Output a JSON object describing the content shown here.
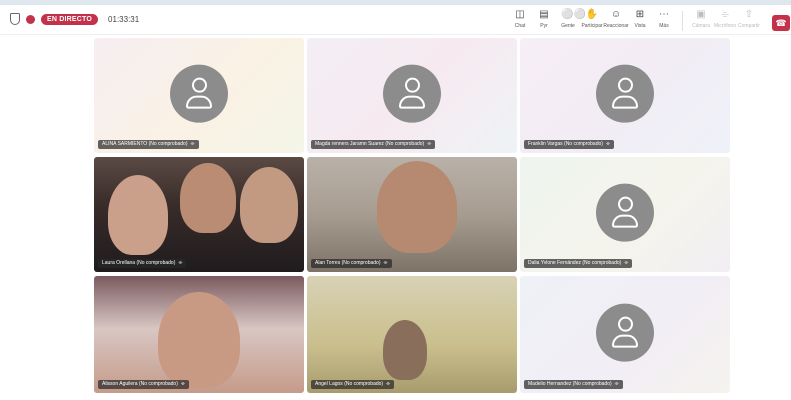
{
  "header": {
    "live_label": "EN DIRECTO",
    "timer": "01:33:31"
  },
  "toolbar": {
    "items": [
      {
        "label": "Chat",
        "icon": "chat-icon"
      },
      {
        "label": "Pyr",
        "icon": "qa-icon"
      },
      {
        "label": "Gente",
        "icon": "people-icon"
      },
      {
        "label": "Participar",
        "icon": "hand-icon"
      },
      {
        "label": "Reaccionar",
        "icon": "smile-icon"
      },
      {
        "label": "Vista",
        "icon": "grid-icon"
      },
      {
        "label": "Más",
        "icon": "more-icon"
      },
      {
        "label": "Cámara",
        "icon": "camera-icon"
      },
      {
        "label": "Micrófono",
        "icon": "mic-icon"
      },
      {
        "label": "Compartir",
        "icon": "share-icon"
      }
    ]
  },
  "participants": [
    {
      "name": "ALINA SARMIENTO (No comprobado)"
    },
    {
      "name": "Magda renners Jaramn Suarez (No comprobado)"
    },
    {
      "name": "Franklin Vargas (No comprobado)"
    },
    {
      "name": "Laura Orellana (No comprobado)"
    },
    {
      "name": "Alan Torres (No comprobado)"
    },
    {
      "name": "Dalia Yvlone Fernández (No comprobado)"
    },
    {
      "name": "Alisson Aguilera (No comprobado)"
    },
    {
      "name": "Angel Lagos (No comprobado)"
    },
    {
      "name": "Madelio Hernandez (No comprobado)"
    }
  ]
}
